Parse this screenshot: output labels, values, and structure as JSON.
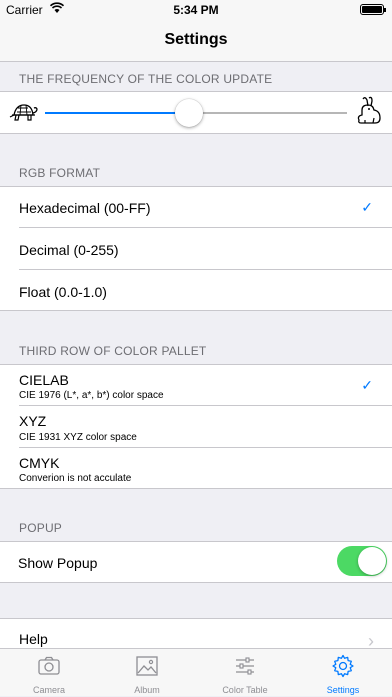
{
  "status_bar": {
    "carrier": "Carrier",
    "time": "5:34 PM"
  },
  "nav": {
    "title": "Settings"
  },
  "frequency": {
    "header": "THE FREQUENCY OF THE COLOR UPDATE",
    "slider_value_fraction": 0.47,
    "min_icon": "turtle-icon",
    "max_icon": "rabbit-icon"
  },
  "rgb_format": {
    "header": "RGB FORMAT",
    "options": [
      {
        "label": "Hexadecimal (00-FF)",
        "selected": true
      },
      {
        "label": "Decimal (0-255)",
        "selected": false
      },
      {
        "label": "Float (0.0-1.0)",
        "selected": false
      }
    ],
    "checkmark": "✓"
  },
  "third_row": {
    "header": "THIRD ROW OF COLOR PALLET",
    "options": [
      {
        "title": "CIELAB",
        "subtitle": "CIE 1976 (L*, a*, b*) color space",
        "selected": true
      },
      {
        "title": "XYZ",
        "subtitle": "CIE 1931 XYZ color space",
        "selected": false
      },
      {
        "title": "CMYK",
        "subtitle": "Converion is not acculate",
        "selected": false
      }
    ],
    "checkmark": "✓"
  },
  "popup": {
    "header": "POPUP",
    "label": "Show Popup",
    "enabled": true
  },
  "help": {
    "label": "Help",
    "chevron": "›"
  },
  "tabs": [
    {
      "label": "Camera",
      "icon": "camera-icon",
      "active": false
    },
    {
      "label": "Album",
      "icon": "photo-icon",
      "active": false
    },
    {
      "label": "Color Table",
      "icon": "sliders-icon",
      "active": false
    },
    {
      "label": "Settings",
      "icon": "gear-icon",
      "active": true
    }
  ],
  "colors": {
    "accent": "#007aff",
    "switch_on": "#4cd964",
    "background": "#efeff4"
  }
}
